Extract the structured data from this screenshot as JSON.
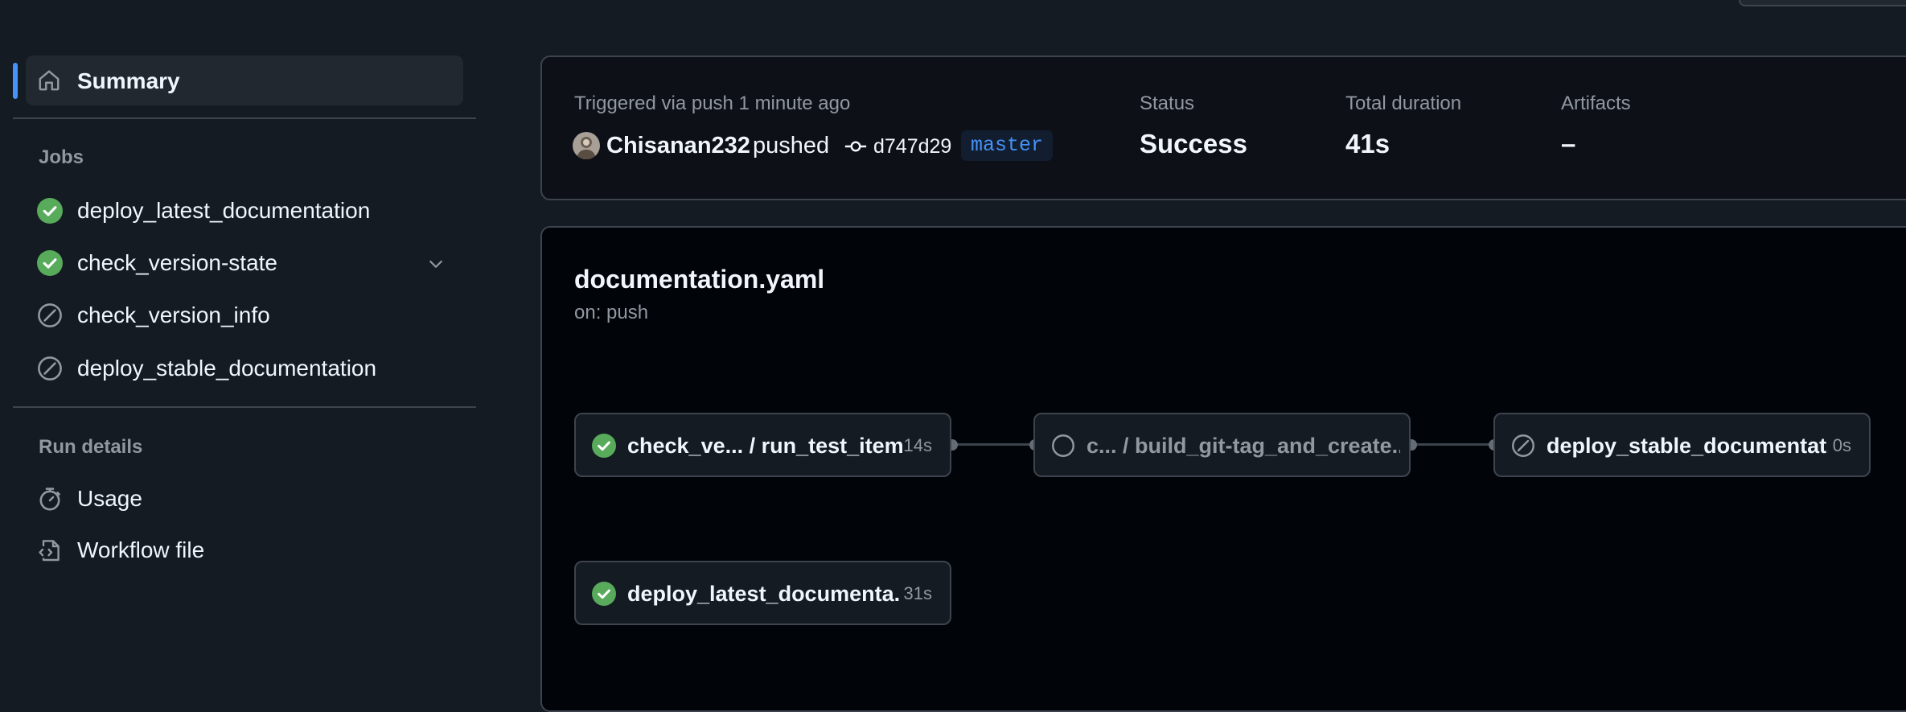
{
  "sidebar": {
    "summary_label": "Summary",
    "jobs_heading": "Jobs",
    "jobs": [
      {
        "label": "deploy_latest_documentation",
        "status": "success"
      },
      {
        "label": "check_version-state",
        "status": "success",
        "expandable": true
      },
      {
        "label": "check_version_info",
        "status": "skipped"
      },
      {
        "label": "deploy_stable_documentation",
        "status": "skipped"
      }
    ],
    "run_details_heading": "Run details",
    "run_details": [
      {
        "label": "Usage",
        "icon": "stopwatch-icon"
      },
      {
        "label": "Workflow file",
        "icon": "file-code-icon"
      }
    ]
  },
  "run_info": {
    "trigger_text": "Triggered via push 1 minute ago",
    "actor": "Chisanan232",
    "action": "pushed",
    "commit_sha": "d747d29",
    "branch": "master",
    "status_label": "Status",
    "status_value": "Success",
    "duration_label": "Total duration",
    "duration_value": "41s",
    "artifacts_label": "Artifacts",
    "artifacts_value": "–"
  },
  "workflow": {
    "file_name": "documentation.yaml",
    "trigger": "on: push",
    "nodes": [
      {
        "label": "check_ve... / run_test_items",
        "duration": "14s",
        "status": "success"
      },
      {
        "label": "c... / build_git-tag_and_create...",
        "duration": "",
        "status": "pending"
      },
      {
        "label": "deploy_stable_documentat...",
        "duration": "0s",
        "status": "skipped"
      },
      {
        "label": "deploy_latest_documenta...",
        "duration": "31s",
        "status": "success"
      }
    ]
  },
  "colors": {
    "success": "#57ab5a",
    "accent": "#4493f8",
    "muted": "#9198a1"
  }
}
